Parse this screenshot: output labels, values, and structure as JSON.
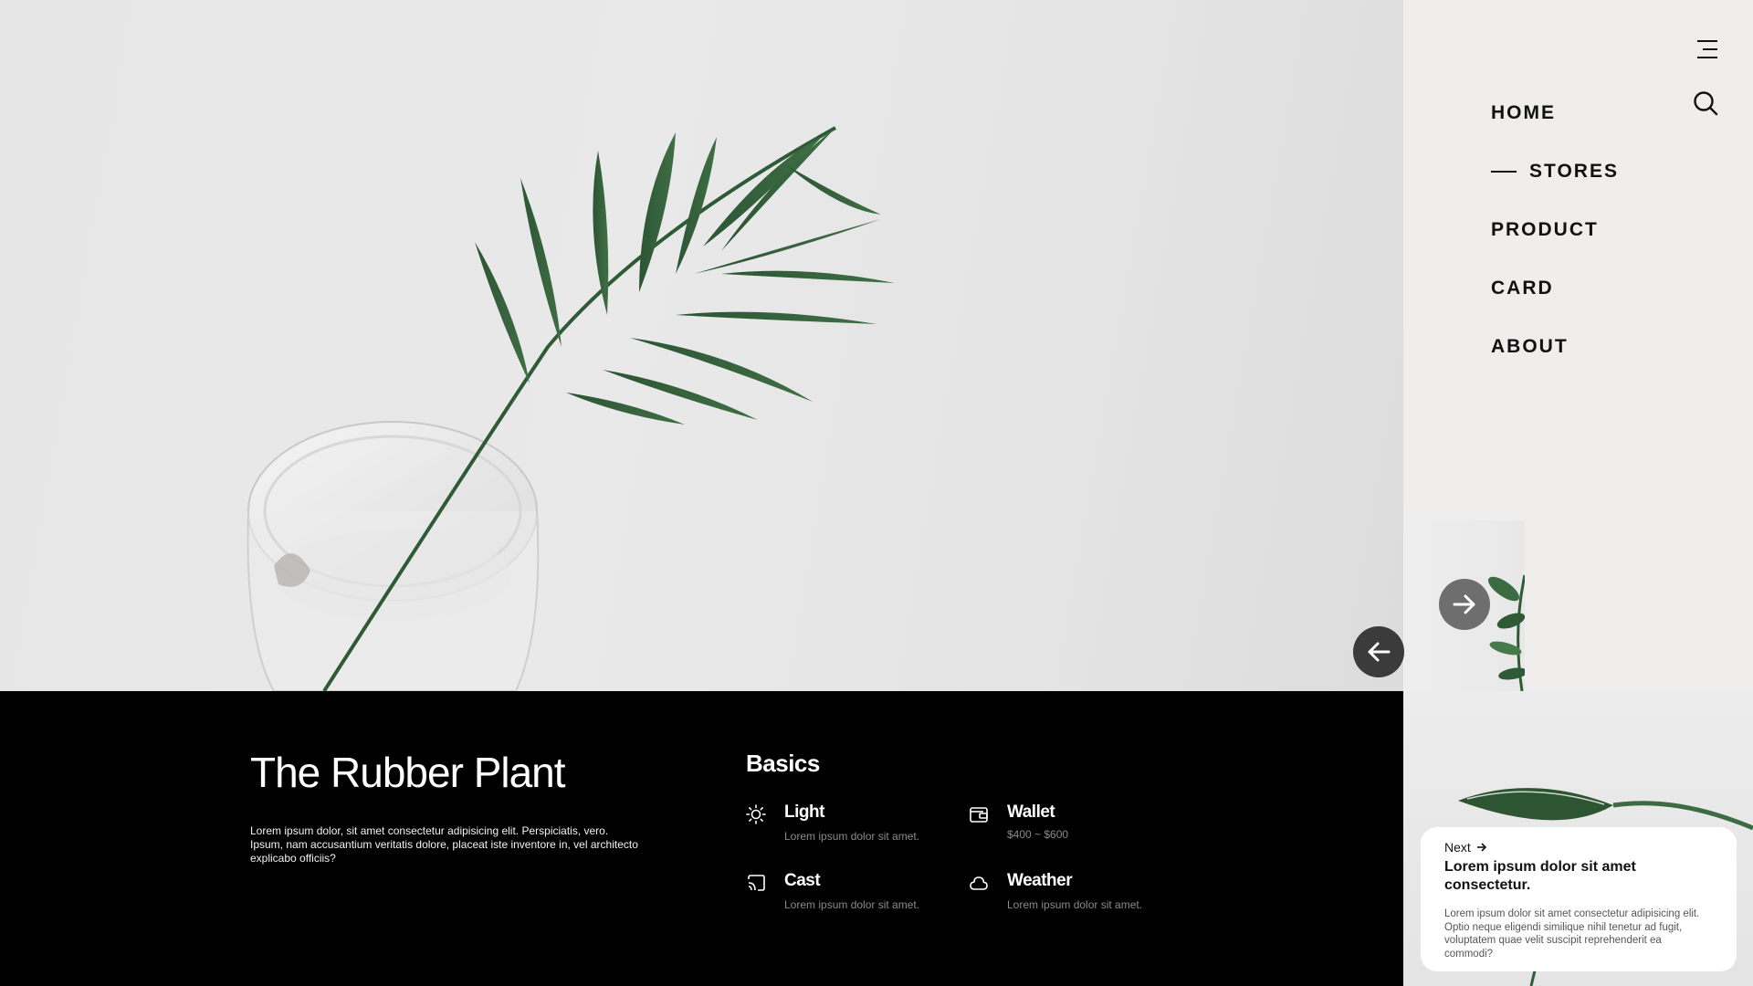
{
  "nav": {
    "items": [
      {
        "label": "HOME",
        "active": false
      },
      {
        "label": "STORES",
        "active": true
      },
      {
        "label": "PRODUCT",
        "active": false
      },
      {
        "label": "CARD",
        "active": false
      },
      {
        "label": "ABOUT",
        "active": false
      }
    ],
    "icons": [
      "menu-icon",
      "search-icon"
    ]
  },
  "slider": {
    "prev_icon": "arrow-left-icon",
    "next_icon": "arrow-right-icon"
  },
  "product": {
    "title": "The Rubber Plant",
    "description": "Lorem ipsum dolor, sit amet consectetur adipisicing elit. Perspiciatis, vero. Ipsum, nam accusantium veritatis dolore, placeat iste inventore in, vel architecto explicabo officiis?"
  },
  "basics": {
    "heading": "Basics",
    "items": [
      {
        "name": "Light",
        "desc": "Lorem ipsum dolor sit amet.",
        "icon": "sun-icon"
      },
      {
        "name": "Wallet",
        "desc": "$400 ~ $600",
        "icon": "wallet-icon"
      },
      {
        "name": "Cast",
        "desc": "Lorem ipsum dolor sit amet.",
        "icon": "cast-icon"
      },
      {
        "name": "Weather",
        "desc": "Lorem ipsum dolor sit amet.",
        "icon": "cloud-icon"
      }
    ]
  },
  "next_card": {
    "label": "Next",
    "title": "Lorem ipsum dolor sit amet consectetur.",
    "body": "Lorem ipsum dolor sit amet consectetur adipisicing elit. Optio neque eligendi similique nihil tenetur ad fugit, voluptatem quae velit suscipit reprehenderit ea commodi?"
  },
  "colors": {
    "background_hero": "#e6e6e6",
    "sidebar": "#efeeed",
    "info_panel": "#000000",
    "leaf": "#2f5a36",
    "text_light": "#ffffff",
    "text_muted": "#8a8a8a"
  }
}
